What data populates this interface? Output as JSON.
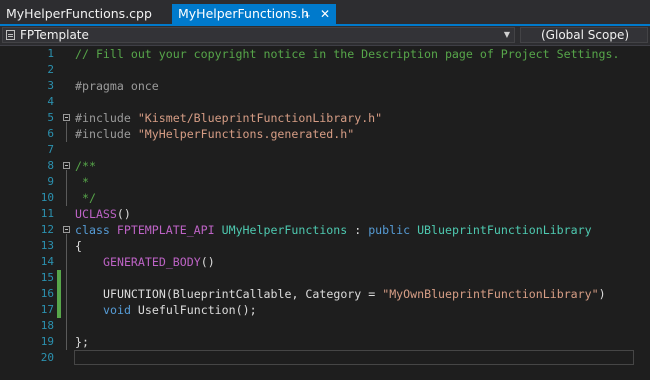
{
  "tabs": [
    {
      "label": "MyHelperFunctions.cpp",
      "active": false
    },
    {
      "label": "MyHelperFunctions.h",
      "active": true,
      "pin_icon": "pin-icon",
      "close_icon": "close-icon"
    }
  ],
  "nav": {
    "project": "FPTemplate",
    "scope": "(Global Scope)"
  },
  "colors": {
    "accent": "#007acc",
    "background": "#1e1e1e",
    "line_number": "#2b91af",
    "comment": "#57a64a",
    "keyword": "#569cd6",
    "string": "#d69d85",
    "macro": "#bd63c5",
    "type": "#4ec9b0"
  },
  "code": {
    "line1": {
      "n": "1",
      "comment": "// Fill out your copyright notice in the Description page of Project Settings."
    },
    "line2": {
      "n": "2"
    },
    "line3": {
      "n": "3",
      "pragma": "#pragma once"
    },
    "line4": {
      "n": "4"
    },
    "line5": {
      "n": "5",
      "directive": "#include",
      "path": "\"Kismet/BlueprintFunctionLibrary.h\""
    },
    "line6": {
      "n": "6",
      "directive": "#include",
      "path": "\"MyHelperFunctions.generated.h\""
    },
    "line7": {
      "n": "7"
    },
    "line8": {
      "n": "8",
      "comment": "/**"
    },
    "line9": {
      "n": "9",
      "comment": " *"
    },
    "line10": {
      "n": "10",
      "comment": " */"
    },
    "line11": {
      "n": "11",
      "macro": "UCLASS",
      "rest": "()"
    },
    "line12": {
      "n": "12",
      "kw_class": "class",
      "api": "FPTEMPLATE_API",
      "name": "UMyHelperFunctions",
      "colon": " : ",
      "kw_public": "public",
      "base": "UBlueprintFunctionLibrary"
    },
    "line13": {
      "n": "13",
      "text": "{"
    },
    "line14": {
      "n": "14",
      "macro": "GENERATED_BODY",
      "rest": "()"
    },
    "line15": {
      "n": "15"
    },
    "line16": {
      "n": "16",
      "ufn": "UFUNCTION",
      "open": "(BlueprintCallable, Category = ",
      "str": "\"MyOwnBlueprintFunctionLibrary\"",
      "close": ")"
    },
    "line17": {
      "n": "17",
      "kw_void": "void",
      "fn": "UsefulFunction",
      "rest": "();"
    },
    "line18": {
      "n": "18"
    },
    "line19": {
      "n": "19",
      "text": "};"
    },
    "line20": {
      "n": "20"
    }
  }
}
